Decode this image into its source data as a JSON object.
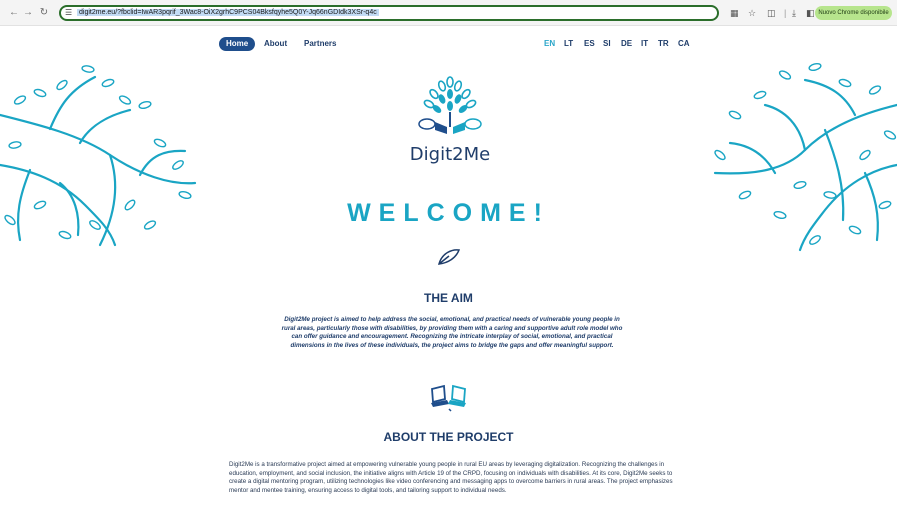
{
  "browser": {
    "url": "digit2me.eu/?fbclid=IwAR3pqrif_3Wac8-OiX2grhC9PCS04Bksfqyhe5Q0Y-Jq66nGDIdk3XSr-q4c",
    "update_badge": "Nuovo Chrome disponibile",
    "icons": [
      "back-icon",
      "forward-icon",
      "reload-icon",
      "site-info-icon",
      "translate-icon",
      "star-icon",
      "extensions-icon",
      "download-icon",
      "sidepanel-icon",
      "profile-icon"
    ]
  },
  "nav": {
    "links": [
      {
        "label": "Home",
        "active": true
      },
      {
        "label": "About",
        "active": false
      },
      {
        "label": "Partners",
        "active": false
      }
    ],
    "languages": [
      {
        "code": "EN",
        "active": true
      },
      {
        "code": "LT",
        "active": false
      },
      {
        "code": "ES",
        "active": false
      },
      {
        "code": "SI",
        "active": false
      },
      {
        "code": "DE",
        "active": false
      },
      {
        "code": "IT",
        "active": false
      },
      {
        "code": "TR",
        "active": false
      },
      {
        "code": "CA",
        "active": false
      }
    ]
  },
  "brand": {
    "logo_text": "Digit2Me"
  },
  "hero": {
    "title": "WELCOME!"
  },
  "aim": {
    "heading": "THE AIM",
    "text": "Digit2Me project is aimed to help address the social, emotional, and practical needs of vulnerable young people in rural areas, particularly those with disabilities, by providing them with a caring and supportive adult role model who can offer guidance and encouragement. Recognizing the intricate interplay of social, emotional, and practical dimensions in the lives of these individuals, the project aims to bridge the gaps and offer meaningful support."
  },
  "about": {
    "heading": "ABOUT THE PROJECT",
    "text": "Digit2Me is a transformative project aimed at empowering vulnerable young people in rural EU areas by leveraging digitalization. Recognizing the challenges in education, employment, and social inclusion, the initiative aligns with Article 19 of the CRPD, focusing on individuals with disabilities. At its core, Digit2Me seeks to create a digital mentoring program, utilizing technologies like video conferencing and messaging apps to overcome barriers in rural areas. The project emphasizes mentor and mentee training, ensuring access to digital tools, and tailoring support to individual needs."
  },
  "colors": {
    "accent": "#1aa5c4",
    "navy": "#1f3d6a",
    "active_pill": "#1f4e8c",
    "url_border": "#2b6e2b"
  }
}
